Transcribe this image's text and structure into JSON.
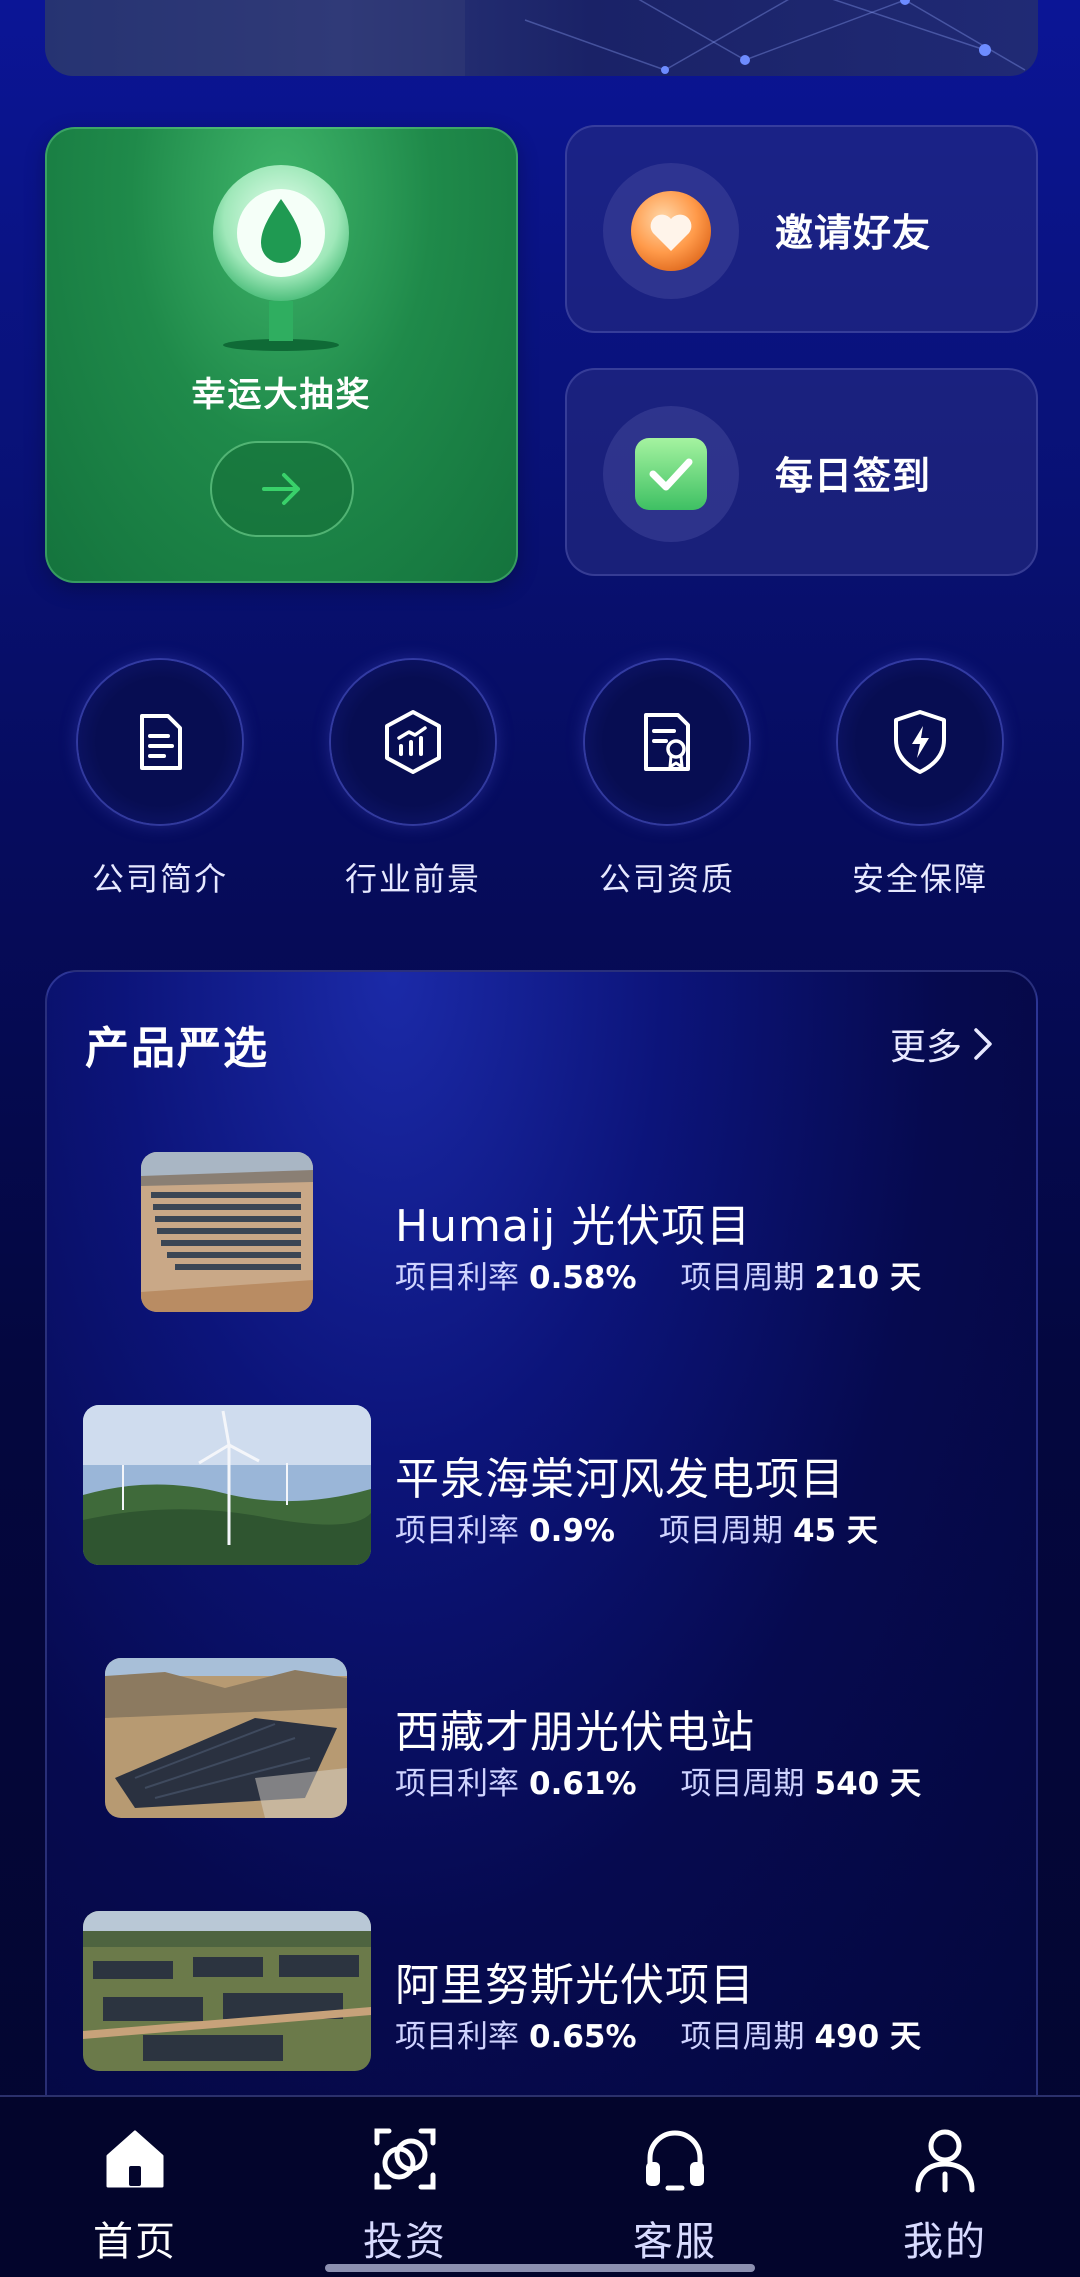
{
  "cards": {
    "lottery_label": "幸运大抽奖",
    "invite_label": "邀请好友",
    "checkin_label": "每日签到"
  },
  "quick_menu": [
    {
      "label": "公司简介",
      "icon": "document-icon"
    },
    {
      "label": "行业前景",
      "icon": "growth-chart-icon"
    },
    {
      "label": "公司资质",
      "icon": "certificate-icon"
    },
    {
      "label": "安全保障",
      "icon": "shield-icon"
    }
  ],
  "products": {
    "title": "产品严选",
    "more_label": "更多",
    "rate_label": "项目利率",
    "period_label": "项目周期",
    "items": [
      {
        "name": "Humaij 光伏项目",
        "rate": "0.58%",
        "period": "210 天"
      },
      {
        "name": "平泉海棠河风发电项目",
        "rate": "0.9%",
        "period": "45 天"
      },
      {
        "name": "西藏才朋光伏电站",
        "rate": "0.61%",
        "period": "540 天"
      },
      {
        "name": "阿里努斯光伏项目",
        "rate": "0.65%",
        "period": "490 天"
      }
    ]
  },
  "tabbar": [
    {
      "label": "首页",
      "icon": "home-icon",
      "active": true
    },
    {
      "label": "投资",
      "icon": "invest-icon",
      "active": false
    },
    {
      "label": "客服",
      "icon": "headset-icon",
      "active": false
    },
    {
      "label": "我的",
      "icon": "user-icon",
      "active": false
    }
  ],
  "colors": {
    "background_top": "#0b1596",
    "background_bottom": "#03052e",
    "lottery_green": "#1f8a4a",
    "accent_green": "#39d16a"
  }
}
